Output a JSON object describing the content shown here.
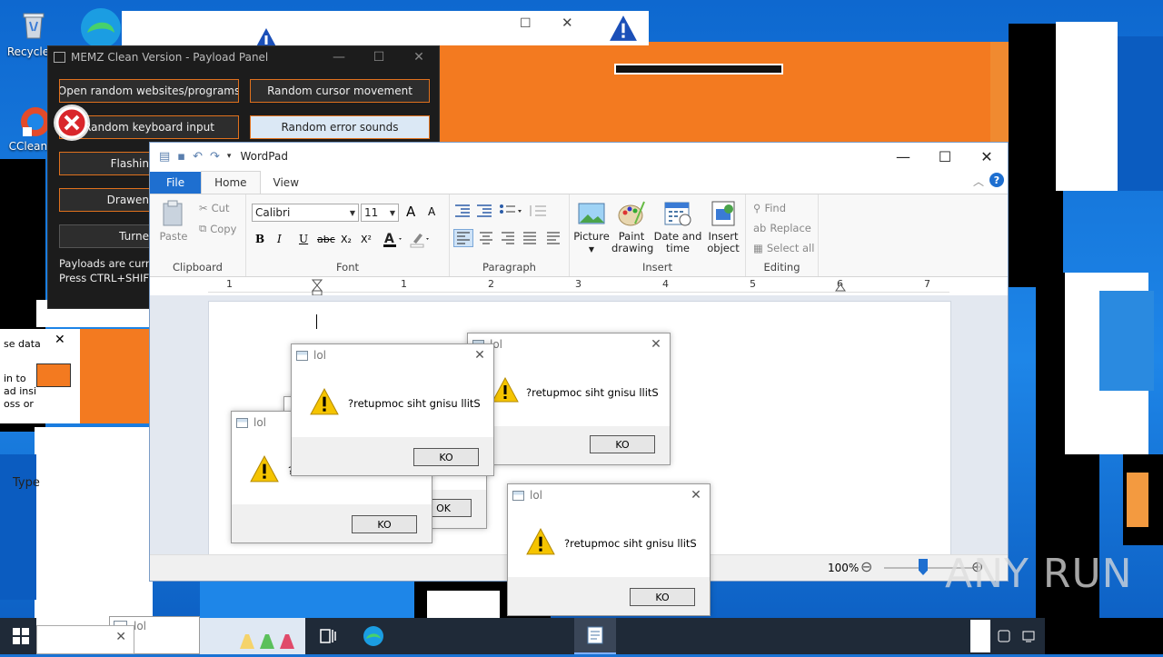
{
  "desktop": {
    "icons": [
      {
        "label": "Recycle B"
      },
      {
        "label": "CCleaner"
      }
    ]
  },
  "background_window": {
    "max_glyph": "☐",
    "close_glyph": "✕"
  },
  "memz": {
    "title": "MEMZ Clean Version - Payload Panel",
    "min_glyph": "—",
    "max_glyph": "☐",
    "close_glyph": "✕",
    "buttons": [
      "Open random websites/programs",
      "Random cursor movement",
      "Random keyboard input",
      "Random error sounds",
      "Flashin",
      "Drawen",
      "Turne"
    ],
    "status_line1": "Payloads are current",
    "status_line2": "Press CTRL+SHIFT+"
  },
  "side_fragment": {
    "text1": "se data",
    "text2": "in to",
    "text3": "ad insi",
    "text4": "oss or",
    "type_text": "Type"
  },
  "wordpad": {
    "title": "WordPad",
    "min_glyph": "—",
    "max_glyph": "☐",
    "close_glyph": "✕",
    "help_glyph": "?",
    "collapse_glyph": "︿",
    "tabs": [
      "File",
      "Home",
      "View"
    ],
    "clipboard": {
      "paste": "Paste",
      "cut": "Cut",
      "copy": "Copy",
      "label": "Clipboard"
    },
    "font": {
      "family": "Calibri",
      "size": "11",
      "label": "Font",
      "grow": "A",
      "shrink": "A",
      "bold": "B",
      "italic": "I",
      "underline": "U",
      "strike": "abc",
      "sub": "X₂",
      "sup": "X²"
    },
    "paragraph": {
      "label": "Paragraph"
    },
    "insert": {
      "picture": "Picture",
      "paint_1": "Paint",
      "paint_2": "drawing",
      "dt_1": "Date and",
      "dt_2": "time",
      "io_1": "Insert",
      "io_2": "object",
      "label": "Insert"
    },
    "editing": {
      "find": "Find",
      "replace": "Replace",
      "select_all": "Select all",
      "label": "Editing"
    },
    "ruler_numbers": [
      "1",
      "1",
      "2",
      "3",
      "4",
      "5",
      "6",
      "7"
    ],
    "zoom": "100%",
    "zoom_out_glyph": "⊖",
    "zoom_in_glyph": "⊕"
  },
  "dialogs": [
    {
      "title": "lol",
      "message": "?retupmoc siht gnisu llitS",
      "ok": "KO"
    },
    {
      "title": "lol",
      "message": "?retupmoc siht gnisu llitS",
      "ok": "KO"
    },
    {
      "title": "lol",
      "message": "?",
      "ok": "KO"
    },
    {
      "title": "lol",
      "message": "?retupmoc siht gnisu llitS",
      "ok": "KO"
    },
    {
      "title": "lol",
      "message": "",
      "ok": "OK"
    },
    {
      "title": "lol",
      "message": "",
      "ok": ""
    }
  ],
  "dialog_close_glyph": "✕",
  "watermark": "ANY RUN",
  "colors": {
    "accent": "#1e6fd0",
    "memz_border": "#e0711d",
    "warning": "#f5c400",
    "taskbar": "#1f2a38"
  }
}
